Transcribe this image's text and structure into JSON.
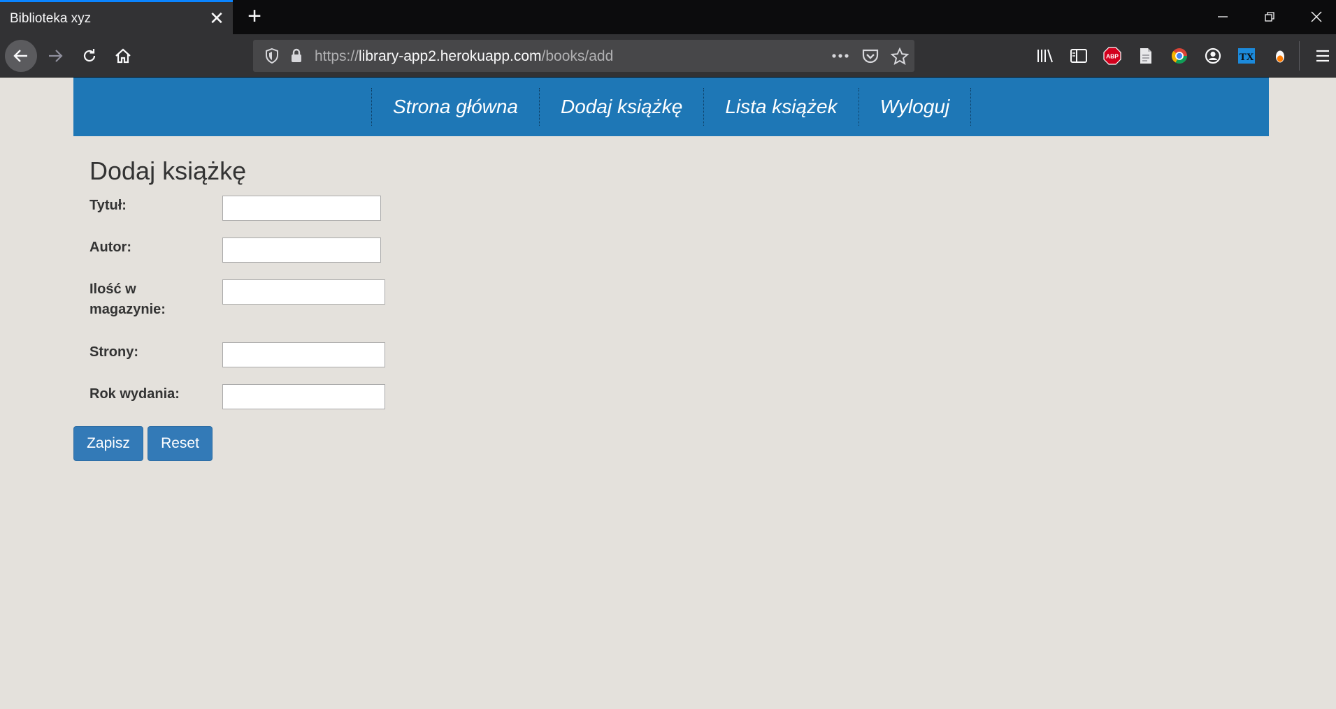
{
  "browser": {
    "tab_title": "Biblioteka xyz",
    "url_scheme": "https://",
    "url_host": "library-app2.herokuapp.com",
    "url_path": "/books/add",
    "abp_label": "ABP",
    "tx_label": "TX"
  },
  "site": {
    "nav": [
      "Strona główna",
      "Dodaj książkę",
      "Lista książek",
      "Wyloguj"
    ]
  },
  "form": {
    "title": "Dodaj książkę",
    "fields": [
      {
        "label": "Tytuł:",
        "value": ""
      },
      {
        "label": "Autor:",
        "value": ""
      },
      {
        "label_line1": "Ilość w",
        "label_line2": "magazynie:",
        "value": ""
      },
      {
        "label": "Strony:",
        "value": ""
      },
      {
        "label": "Rok wydania:",
        "value": ""
      }
    ],
    "submit_label": "Zapisz",
    "reset_label": "Reset"
  },
  "colors": {
    "nav_bg": "#1e77b6",
    "button_bg": "#337ab7",
    "page_bg": "#e4e1dc",
    "tab_accent": "#0a84ff"
  }
}
